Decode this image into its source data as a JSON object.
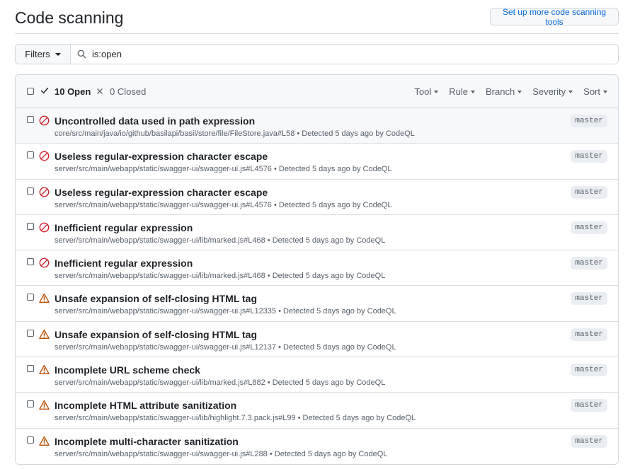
{
  "header": {
    "title": "Code scanning",
    "setup_button": "Set up more code scanning tools"
  },
  "filter_bar": {
    "filters_label": "Filters",
    "search_value": "is:open"
  },
  "list_header": {
    "open_label": "10 Open",
    "closed_label": "0 Closed",
    "menus": [
      "Tool",
      "Rule",
      "Branch",
      "Severity",
      "Sort"
    ]
  },
  "colors": {
    "error": "#cf222e",
    "warning": "#bc4c00"
  },
  "alerts": [
    {
      "severity": "error",
      "icon": "stop-icon",
      "title": "Uncontrolled data used in path expression",
      "meta": "core/src/main/java/io/github/basilapi/basil/store/file/FileStore.java#L58 • Detected 5 days ago by CodeQL",
      "branch": "master"
    },
    {
      "severity": "error",
      "icon": "stop-icon",
      "title": "Useless regular-expression character escape",
      "meta": "server/src/main/webapp/static/swagger-ui/swagger-ui.js#L4576 • Detected 5 days ago by CodeQL",
      "branch": "master"
    },
    {
      "severity": "error",
      "icon": "stop-icon",
      "title": "Useless regular-expression character escape",
      "meta": "server/src/main/webapp/static/swagger-ui/swagger-ui.js#L4576 • Detected 5 days ago by CodeQL",
      "branch": "master"
    },
    {
      "severity": "error",
      "icon": "stop-icon",
      "title": "Inefficient regular expression",
      "meta": "server/src/main/webapp/static/swagger-ui/lib/marked.js#L468 • Detected 5 days ago by CodeQL",
      "branch": "master"
    },
    {
      "severity": "error",
      "icon": "stop-icon",
      "title": "Inefficient regular expression",
      "meta": "server/src/main/webapp/static/swagger-ui/lib/marked.js#L468 • Detected 5 days ago by CodeQL",
      "branch": "master"
    },
    {
      "severity": "warning",
      "icon": "alert-icon",
      "title": "Unsafe expansion of self-closing HTML tag",
      "meta": "server/src/main/webapp/static/swagger-ui/swagger-ui.js#L12335 • Detected 5 days ago by CodeQL",
      "branch": "master"
    },
    {
      "severity": "warning",
      "icon": "alert-icon",
      "title": "Unsafe expansion of self-closing HTML tag",
      "meta": "server/src/main/webapp/static/swagger-ui/swagger-ui.js#L12137 • Detected 5 days ago by CodeQL",
      "branch": "master"
    },
    {
      "severity": "warning",
      "icon": "alert-icon",
      "title": "Incomplete URL scheme check",
      "meta": "server/src/main/webapp/static/swagger-ui/lib/marked.js#L882 • Detected 5 days ago by CodeQL",
      "branch": "master"
    },
    {
      "severity": "warning",
      "icon": "alert-icon",
      "title": "Incomplete HTML attribute sanitization",
      "meta": "server/src/main/webapp/static/swagger-ui/lib/highlight.7.3.pack.js#L99 • Detected 5 days ago by CodeQL",
      "branch": "master"
    },
    {
      "severity": "warning",
      "icon": "alert-icon",
      "title": "Incomplete multi-character sanitization",
      "meta": "server/src/main/webapp/static/swagger-ui/swagger-ui.js#L288 • Detected 5 days ago by CodeQL",
      "branch": "master"
    }
  ]
}
